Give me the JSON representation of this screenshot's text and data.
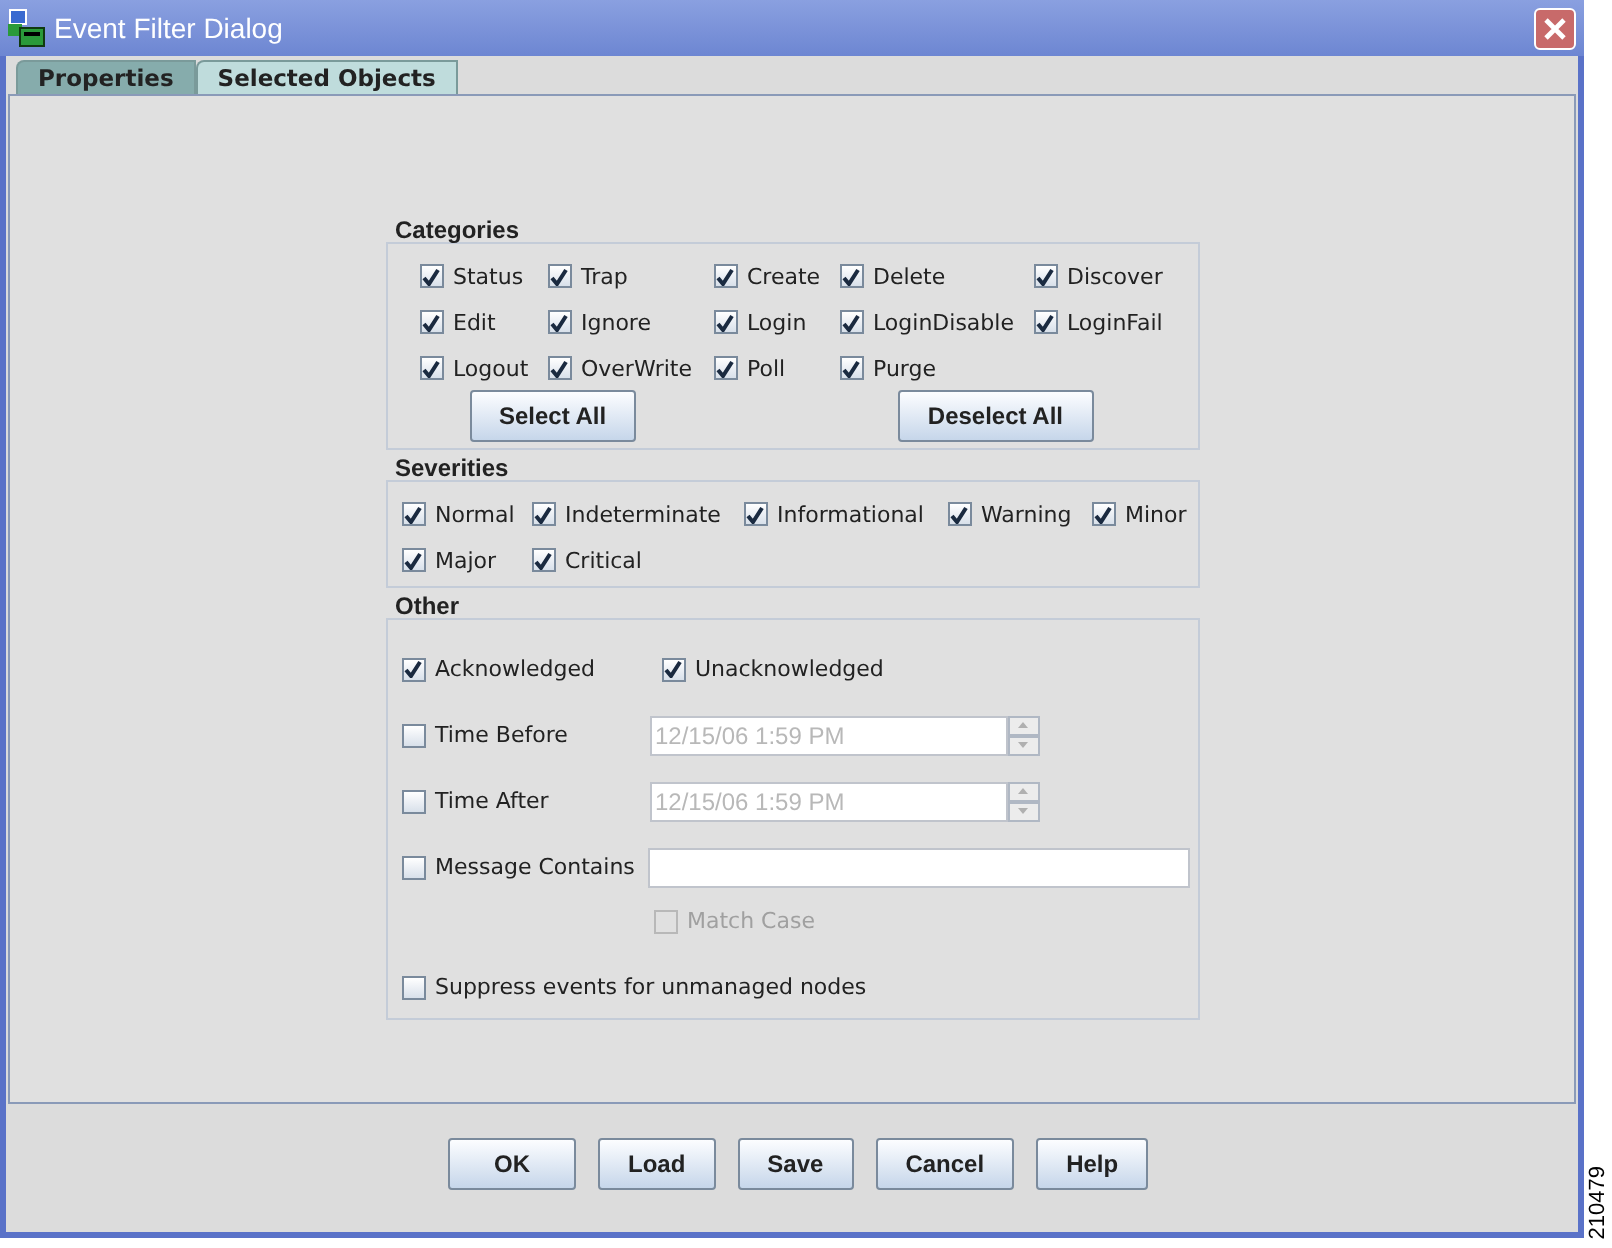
{
  "window": {
    "title": "Event Filter Dialog"
  },
  "tabs": [
    {
      "label": "Properties",
      "selected": true
    },
    {
      "label": "Selected Objects",
      "selected": false
    }
  ],
  "categories": {
    "title": "Categories",
    "items": [
      {
        "label": "Status",
        "checked": true
      },
      {
        "label": "Trap",
        "checked": true
      },
      {
        "label": "Create",
        "checked": true
      },
      {
        "label": "Delete",
        "checked": true
      },
      {
        "label": "Discover",
        "checked": true
      },
      {
        "label": "Edit",
        "checked": true
      },
      {
        "label": "Ignore",
        "checked": true
      },
      {
        "label": "Login",
        "checked": true
      },
      {
        "label": "LoginDisable",
        "checked": true
      },
      {
        "label": "LoginFail",
        "checked": true
      },
      {
        "label": "Logout",
        "checked": true
      },
      {
        "label": "OverWrite",
        "checked": true
      },
      {
        "label": "Poll",
        "checked": true
      },
      {
        "label": "Purge",
        "checked": true
      }
    ],
    "buttons": [
      "Select All",
      "Deselect All"
    ]
  },
  "severities": {
    "title": "Severities",
    "rows": [
      [
        {
          "label": "Normal",
          "checked": true
        },
        {
          "label": "Indeterminate",
          "checked": true
        },
        {
          "label": "Informational",
          "checked": true
        },
        {
          "label": "Warning",
          "checked": true
        },
        {
          "label": "Minor",
          "checked": true
        }
      ],
      [
        {
          "label": "Major",
          "checked": true
        },
        {
          "label": "Critical",
          "checked": true
        }
      ]
    ]
  },
  "other": {
    "title": "Other",
    "rows": [
      {
        "kind": "pair",
        "items": [
          {
            "label": "Acknowledged",
            "checked": true
          },
          {
            "label": "Unacknowledged",
            "checked": true
          }
        ]
      },
      {
        "kind": "time",
        "label": "Time Before",
        "checked": false,
        "value": "12/15/06 1:59 PM",
        "disabled": true
      },
      {
        "kind": "time",
        "label": "Time After",
        "checked": false,
        "value": "12/15/06 1:59 PM",
        "disabled": true
      },
      {
        "kind": "text",
        "label": "Message Contains",
        "checked": false
      },
      {
        "kind": "sub",
        "label": "Match Case",
        "checked": false,
        "disabled": true
      },
      {
        "kind": "check",
        "label": "Suppress events for unmanaged nodes",
        "checked": false
      }
    ]
  },
  "buttons": [
    "OK",
    "Load",
    "Save",
    "Cancel",
    "Help"
  ],
  "figure_id": "210479"
}
